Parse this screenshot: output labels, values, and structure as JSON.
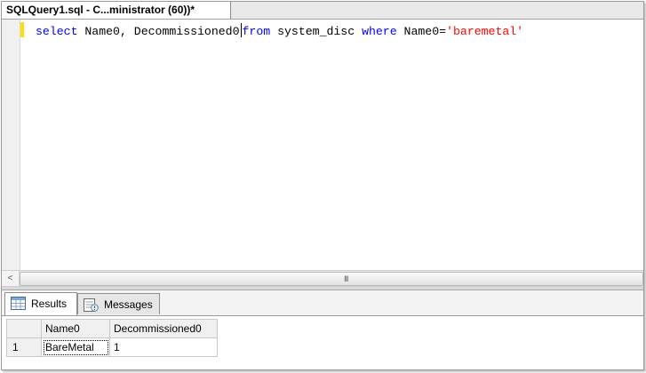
{
  "document_tab": {
    "title": "SQLQuery1.sql - C...ministrator (60))*"
  },
  "editor": {
    "tokens": {
      "select": "select",
      "part1": " Name0, Decommissioned0",
      "from": "from",
      "part2": " system_disc ",
      "where": "where",
      "part3": " Name0=",
      "value": "'baremetal'"
    }
  },
  "scrollbar": {
    "left_arrow": "<",
    "grip": "III"
  },
  "results_tabs": [
    {
      "label": "Results",
      "icon": "grid-icon"
    },
    {
      "label": "Messages",
      "icon": "messages-icon"
    }
  ],
  "grid": {
    "columns": [
      "Name0",
      "Decommissioned0"
    ],
    "rows": [
      {
        "row_number": "1",
        "cells": [
          "BareMetal",
          "1"
        ]
      }
    ]
  },
  "colors": {
    "keyword": "#0000ff",
    "string": "#ff0000",
    "change_marker": "#ffe000"
  }
}
